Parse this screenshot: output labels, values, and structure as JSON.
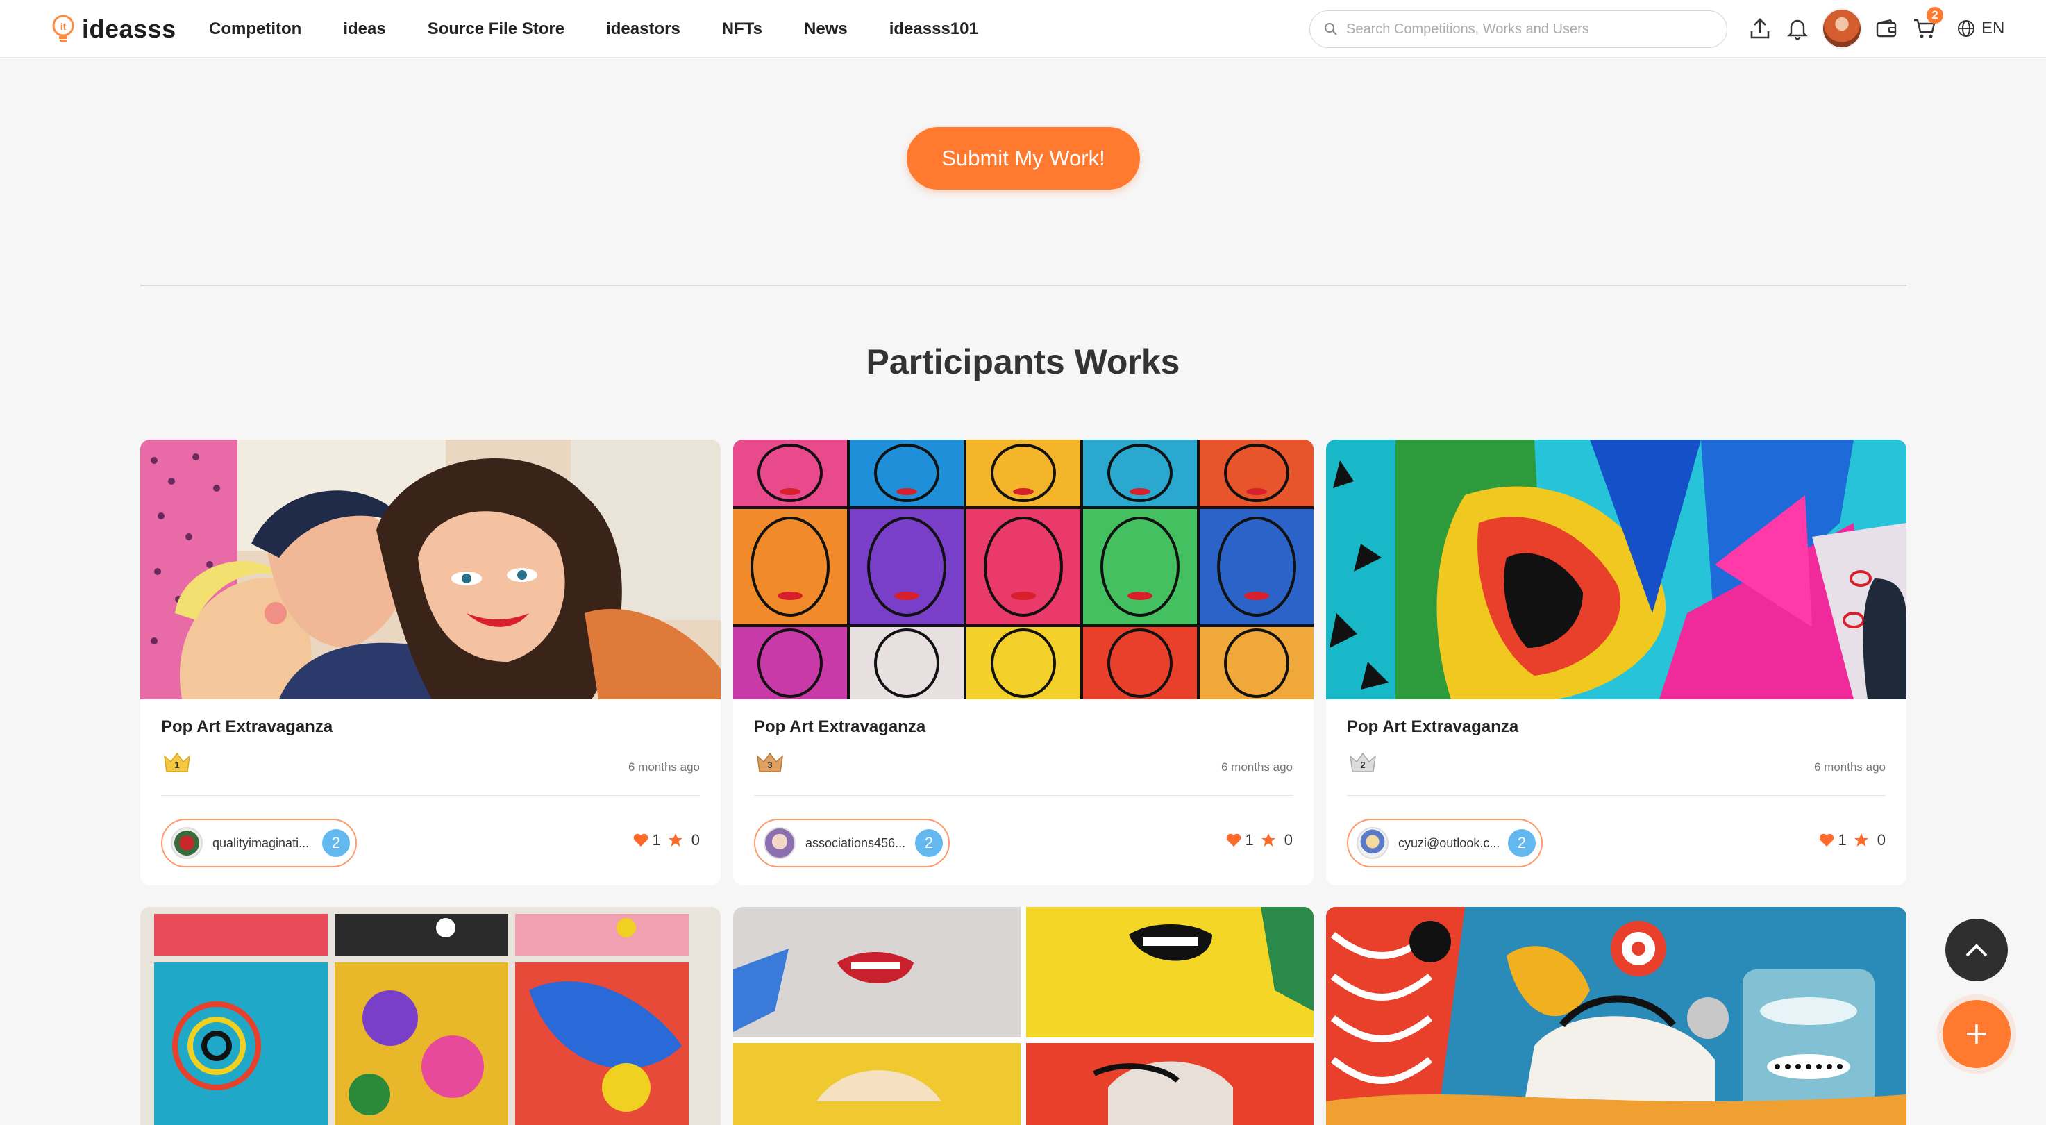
{
  "brand": {
    "name": "ideasss"
  },
  "nav": {
    "items": [
      {
        "label": "Competiton"
      },
      {
        "label": "ideas"
      },
      {
        "label": "Source File Store"
      },
      {
        "label": "ideastors"
      },
      {
        "label": "NFTs"
      },
      {
        "label": "News"
      },
      {
        "label": "ideasss101"
      }
    ],
    "search_placeholder": "Search Competitions, Works and Users",
    "cart_count": "2",
    "language": "EN",
    "icons": [
      "search-icon",
      "upload-icon",
      "bell-icon",
      "avatar",
      "wallet-icon",
      "cart-icon",
      "globe-icon"
    ]
  },
  "main": {
    "submit_label": "Submit My Work!",
    "section_title": "Participants Works"
  },
  "works": [
    {
      "title": "Pop Art Extravaganza",
      "rank": "1",
      "time": "6 months ago",
      "user": "qualityimaginati...",
      "level": "2",
      "likes": "1",
      "stars": "0"
    },
    {
      "title": "Pop Art Extravaganza",
      "rank": "3",
      "time": "6 months ago",
      "user": "associations456...",
      "level": "2",
      "likes": "1",
      "stars": "0"
    },
    {
      "title": "Pop Art Extravaganza",
      "rank": "2",
      "time": "6 months ago",
      "user": "cyuzi@outlook.c...",
      "level": "2",
      "likes": "1",
      "stars": "0"
    }
  ],
  "colors": {
    "accent": "#ff7a2f",
    "level_badge": "#63b8f0",
    "dark_fab": "#2f2f2f"
  }
}
